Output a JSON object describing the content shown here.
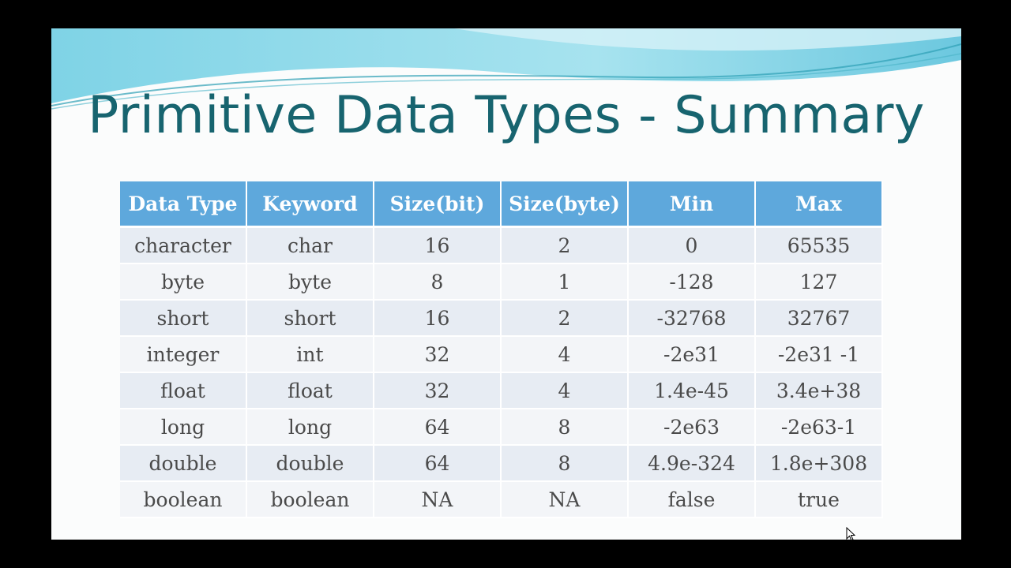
{
  "slide": {
    "title": "Primitive Data Types - Summary",
    "colors": {
      "title": "#17646f",
      "header_bg": "#5ea8dc",
      "row_odd": "#e7ecf3",
      "row_even": "#f3f5f8"
    }
  },
  "table": {
    "headers": [
      "Data Type",
      "Keyword",
      "Size(bit)",
      "Size(byte)",
      "Min",
      "Max"
    ],
    "rows": [
      [
        "character",
        "char",
        "16",
        "2",
        "0",
        "65535"
      ],
      [
        "byte",
        "byte",
        "8",
        "1",
        "-128",
        "127"
      ],
      [
        "short",
        "short",
        "16",
        "2",
        "-32768",
        "32767"
      ],
      [
        "integer",
        "int",
        "32",
        "4",
        "-2e31",
        "-2e31 -1"
      ],
      [
        "float",
        "float",
        "32",
        "4",
        "1.4e-45",
        "3.4e+38"
      ],
      [
        "long",
        "long",
        "64",
        "8",
        "-2e63",
        "-2e63-1"
      ],
      [
        "double",
        "double",
        "64",
        "8",
        "4.9e-324",
        "1.8e+308"
      ],
      [
        "boolean",
        "boolean",
        "NA",
        "NA",
        "false",
        "true"
      ]
    ]
  }
}
